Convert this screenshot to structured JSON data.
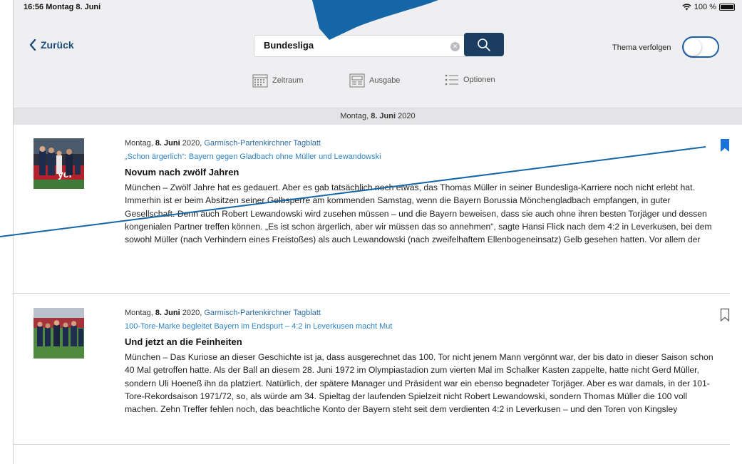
{
  "status_bar": {
    "time_date": "16:56  Montag 8. Juni",
    "battery": "100 %"
  },
  "nav": {
    "back_label": "Zurück"
  },
  "search": {
    "value": "Bundesliga",
    "clear_glyph": "✕",
    "button_icon": "search-icon"
  },
  "follow": {
    "label": "Thema verfolgen",
    "enabled": false
  },
  "toolbar": [
    {
      "label": "Zeitraum",
      "icon": "calendar-icon"
    },
    {
      "label": "Ausgabe",
      "icon": "newspaper-icon"
    },
    {
      "label": "Optionen",
      "icon": "list-icon"
    }
  ],
  "date_bar": {
    "prefix": "Montag,",
    "date_bold": "8. Juni",
    "year": "2020"
  },
  "articles": [
    {
      "weekday": "Montag,",
      "date_bold": "8. Juni",
      "year": "2020,",
      "source": "Garmisch-Partenkirchner Tagblatt",
      "kicker": "„Schon ärgerlich“: Bayern gegen Gladbach ohne Müller und Lewandowski",
      "headline": "Novum nach zwölf Jahren",
      "body": "München – Zwölf Jahre hat es gedauert. Aber es gab tatsächlich noch etwas, das Thomas Müller in seiner Bundesliga-Karriere noch nicht erlebt hat. Immerhin ist er beim Absitzen seiner Gelbsperre am kommenden Samstag, wenn die Bayern Borussia Mönchengladbach empfangen, in guter Gesellschaft. Denn auch Robert Lewandowski wird zusehen müssen – und die Bayern beweisen, dass sie auch ohne ihren besten Torjäger und dessen kongenialen Partner treffen können.        „Es ist schon ärgerlich, aber wir müssen das so annehmen“, sagte Hansi Flick nach dem 4:2 in Leverkusen, bei dem sowohl Müller (nach Verhindern eines Freistoßes) als auch Lewandowski (nach zweifelhaftem Ellenbogeneinsatz) Gelb gesehen hatten. Vor allem der",
      "bookmarked": true
    },
    {
      "weekday": "Montag,",
      "date_bold": "8. Juni",
      "year": "2020,",
      "source": "Garmisch-Partenkirchner Tagblatt",
      "kicker": "100-Tore-Marke begleitet Bayern im Endspurt – 4:2 in Leverkusen macht Mut",
      "headline": "Und jetzt an die Feinheiten",
      "body": "München – Das Kuriose an dieser Geschichte ist ja, dass ausgerechnet das 100. Tor nicht jenem Mann vergönnt war, der bis dato in dieser Saison schon 40 Mal getroffen hatte. Als der Ball an diesem 28. Juni 1972 im Olympiastadion zum vierten Mal im Schalker Kasten zappelte, hatte nicht Gerd Müller, sondern Uli Hoeneß ihn da platziert. Natürlich, der spätere Manager und Präsident war ein ebenso begnadeter Torjäger. Aber es war damals, in der 101-Tore-Rekordsaison 1971/72, so, als würde am 34. Spieltag der laufenden Spielzeit nicht Robert Lewandowski, sondern Thomas Müller die 100 voll machen.        Zehn Treffer fehlen noch, das beachtliche Konto der Bayern steht seit dem verdienten 4:2 in Leverkusen – und den Toren von Kingsley",
      "bookmarked": false
    }
  ],
  "colors": {
    "accent": "#1b3d62",
    "link": "#2e83c4",
    "bookmark": "#1a73d9",
    "annotation": "#1466a6"
  }
}
